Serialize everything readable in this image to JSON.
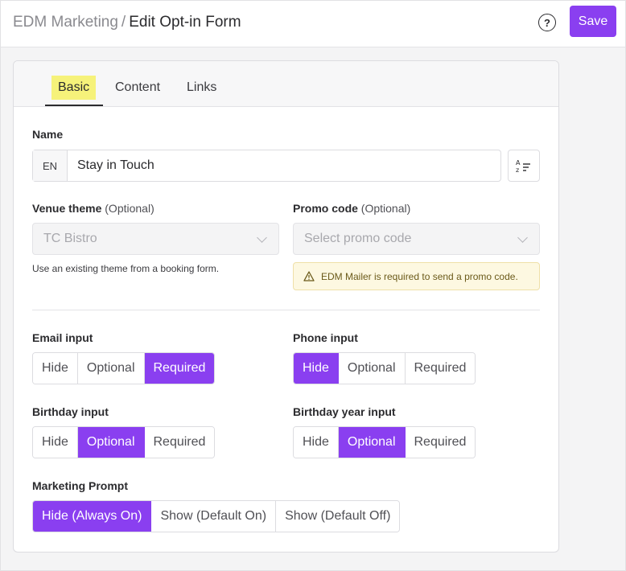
{
  "header": {
    "breadcrumb_parent": "EDM Marketing",
    "breadcrumb_separator": "/",
    "page_title": "Edit Opt-in Form",
    "help_icon": "question-circle-icon",
    "save_label": "Save"
  },
  "tabs": [
    {
      "label": "Basic",
      "active": true
    },
    {
      "label": "Content",
      "active": false
    },
    {
      "label": "Links",
      "active": false
    }
  ],
  "name": {
    "label": "Name",
    "language": "EN",
    "value": "Stay in Touch",
    "translate_icon": "translate-sort-icon"
  },
  "venue_theme": {
    "label": "Venue theme",
    "optional": "(Optional)",
    "value": "TC Bistro",
    "hint": "Use an existing theme from a booking form."
  },
  "promo_code": {
    "label": "Promo code",
    "optional": "(Optional)",
    "placeholder": "Select promo code",
    "warning": "EDM Mailer is required to send a promo code."
  },
  "email_input": {
    "label": "Email input",
    "options": [
      "Hide",
      "Optional",
      "Required"
    ],
    "selected": "Required"
  },
  "phone_input": {
    "label": "Phone input",
    "options": [
      "Hide",
      "Optional",
      "Required"
    ],
    "selected": "Hide"
  },
  "birthday_input": {
    "label": "Birthday input",
    "options": [
      "Hide",
      "Optional",
      "Required"
    ],
    "selected": "Optional"
  },
  "birthday_year_input": {
    "label": "Birthday year input",
    "options": [
      "Hide",
      "Optional",
      "Required"
    ],
    "selected": "Optional"
  },
  "marketing_prompt": {
    "label": "Marketing Prompt",
    "options": [
      "Hide (Always On)",
      "Show (Default On)",
      "Show (Default Off)"
    ],
    "selected": "Hide (Always On)"
  },
  "colors": {
    "accent": "#8a3ff0",
    "tab_highlight": "#f6f27a",
    "warning_bg": "#fdf8e1"
  }
}
